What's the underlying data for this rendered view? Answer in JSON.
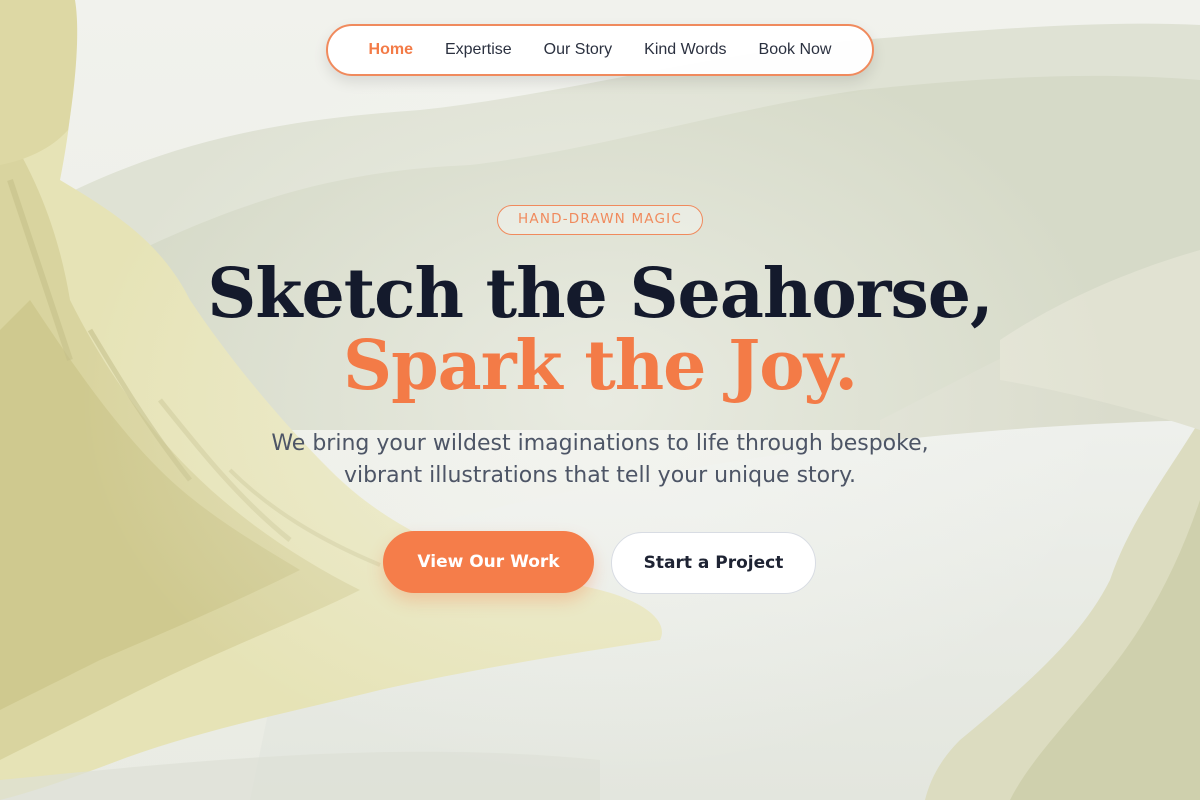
{
  "nav": {
    "items": [
      {
        "label": "Home",
        "active": true
      },
      {
        "label": "Expertise",
        "active": false
      },
      {
        "label": "Our Story",
        "active": false
      },
      {
        "label": "Kind Words",
        "active": false
      },
      {
        "label": "Book Now",
        "active": false
      }
    ]
  },
  "hero": {
    "badge": "HAND-DRAWN MAGIC",
    "headline_line1": "Sketch the Seahorse,",
    "headline_line2": "Spark the Joy.",
    "subtitle": "We bring your wildest imaginations to life through bespoke, vibrant illustrations that tell your unique story.",
    "primary_cta": "View Our Work",
    "secondary_cta": "Start a Project"
  },
  "colors": {
    "accent": "#f37b47",
    "heading": "#141a2c",
    "body_text": "#4d5566"
  }
}
